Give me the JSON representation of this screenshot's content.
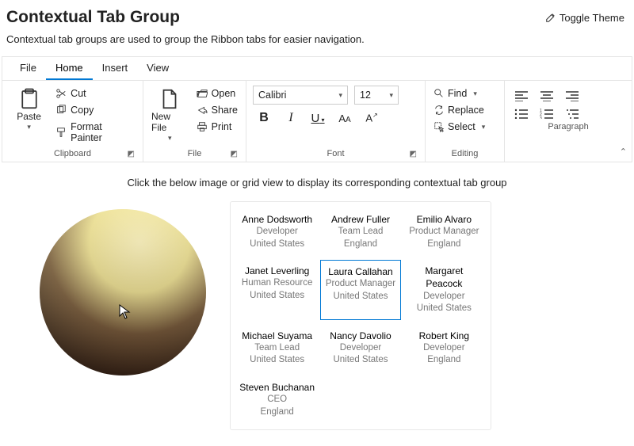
{
  "header": {
    "title": "Contextual Tab Group",
    "toggle": "Toggle Theme"
  },
  "description": "Contextual tab groups are used to group the Ribbon tabs for easier navigation.",
  "tabs": [
    "File",
    "Home",
    "Insert",
    "View"
  ],
  "activeTab": "Home",
  "clipboard": {
    "label": "Clipboard",
    "paste": "Paste",
    "cut": "Cut",
    "copy": "Copy",
    "formatPainter": "Format Painter"
  },
  "fileGroup": {
    "label": "File",
    "newFile": "New File",
    "open": "Open",
    "share": "Share",
    "print": "Print"
  },
  "font": {
    "label": "Font",
    "name": "Calibri",
    "size": "12"
  },
  "editing": {
    "label": "Editing",
    "find": "Find",
    "replace": "Replace",
    "select": "Select"
  },
  "paragraph": {
    "label": "Paragraph"
  },
  "instruction": "Click the below image or grid view to display its corresponding contextual tab group",
  "people": [
    {
      "name": "Anne Dodsworth",
      "role": "Developer",
      "country": "United States"
    },
    {
      "name": "Andrew Fuller",
      "role": "Team Lead",
      "country": "England"
    },
    {
      "name": "Emilio Alvaro",
      "role": "Product Manager",
      "country": "England"
    },
    {
      "name": "Janet Leverling",
      "role": "Human Resource",
      "country": "United States"
    },
    {
      "name": "Laura Callahan",
      "role": "Product Manager",
      "country": "United States"
    },
    {
      "name": "Margaret Peacock",
      "role": "Developer",
      "country": "United States"
    },
    {
      "name": "Michael Suyama",
      "role": "Team Lead",
      "country": "United States"
    },
    {
      "name": "Nancy Davolio",
      "role": "Developer",
      "country": "United States"
    },
    {
      "name": "Robert King",
      "role": "Developer",
      "country": "England"
    },
    {
      "name": "Steven Buchanan",
      "role": "CEO",
      "country": "England"
    }
  ],
  "selectedPerson": 4
}
